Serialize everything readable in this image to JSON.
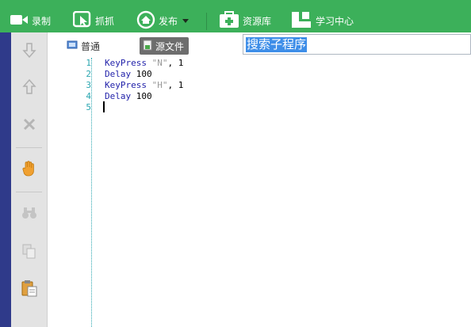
{
  "toolbar": {
    "record": "录制",
    "capture": "抓抓",
    "publish": "发布",
    "resources": "资源库",
    "learning": "学习中心"
  },
  "tabs": {
    "normal": "普通",
    "source": "源文件"
  },
  "search": {
    "text": "搜索子程序"
  },
  "gutter": {
    "lines": [
      "1",
      "2",
      "3",
      "4",
      "5"
    ]
  },
  "code": {
    "line1": {
      "kw": "KeyPress",
      "str": "\"N\"",
      "rest": ", 1"
    },
    "line2": {
      "kw": "Delay",
      "rest": " 100"
    },
    "line3": {
      "kw": "KeyPress",
      "str": "\"H\"",
      "rest": ", 1"
    },
    "line4": {
      "kw": "Delay",
      "rest": " 100"
    }
  },
  "colors": {
    "toolbar": "#3cb05a",
    "sidebar_accent": "#2f3a8a",
    "selection": "#3e8ee8",
    "line_numbers": "#2aa6b0"
  }
}
